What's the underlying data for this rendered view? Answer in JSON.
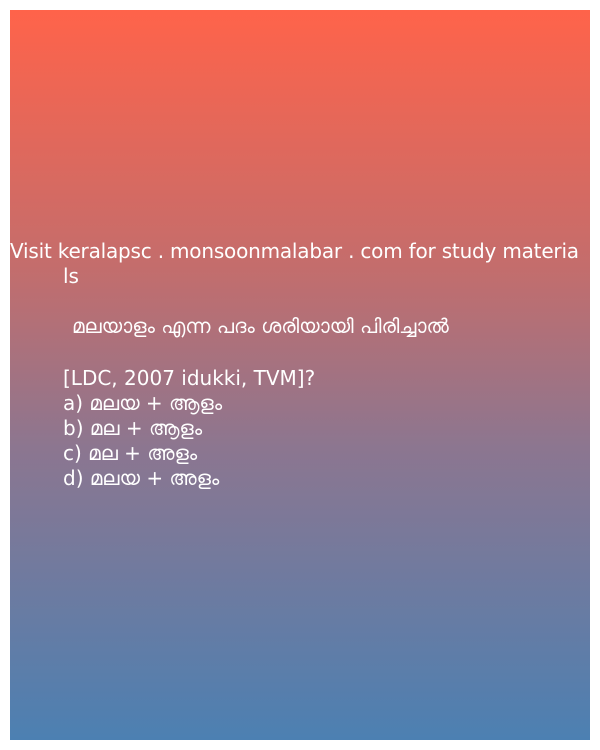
{
  "promo": {
    "line1": "Visit keralapsc . monsoonmalabar . com for study materia",
    "line2": "ls"
  },
  "question": {
    "text": "മലയാളം  എന്ന പദം  ശരിയായി  പിരിച്ചാൽ",
    "meta": "[LDC, 2007 idukki, TVM]?",
    "options": [
      "a) മലയ  + ആളം",
      "b) മല + ആളം",
      "c) മല  + അളം",
      "d) മലയ  + അളം"
    ]
  },
  "colors": {
    "gradient_top": "#ff634a",
    "gradient_bottom": "#4c80b2",
    "text": "#ffffff"
  }
}
